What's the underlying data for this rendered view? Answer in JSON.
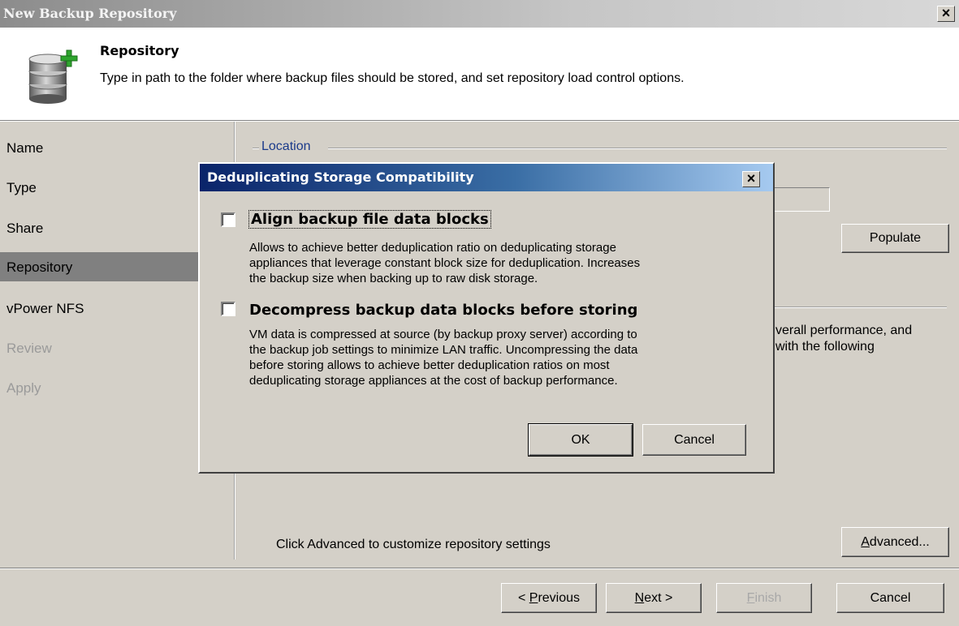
{
  "window": {
    "title": "New Backup Repository",
    "close_glyph": "×"
  },
  "header": {
    "icon": "database-add-icon",
    "title": "Repository",
    "description": "Type in path to the folder where backup files should be stored, and set repository load control options."
  },
  "nav": {
    "selected": "Repository",
    "items": [
      {
        "label": "Name",
        "enabled": true
      },
      {
        "label": "Type",
        "enabled": true
      },
      {
        "label": "Share",
        "enabled": true
      },
      {
        "label": "Repository",
        "enabled": true
      },
      {
        "label": "vPower NFS",
        "enabled": true
      },
      {
        "label": "Review",
        "enabled": false
      },
      {
        "label": "Apply",
        "enabled": false
      }
    ]
  },
  "main": {
    "location_group": "Location",
    "populate_button": "Populate",
    "partial_text_1": "verall performance, and",
    "partial_text_2": "with the following",
    "advanced_hint": "Click Advanced to customize repository settings",
    "advanced_button": {
      "accel": "A",
      "rest": "dvanced..."
    }
  },
  "footer": {
    "previous": {
      "prefix": "< ",
      "accel": "P",
      "rest": "revious"
    },
    "next": {
      "accel": "N",
      "rest": "ext >"
    },
    "finish": {
      "accel": "F",
      "rest": "inish",
      "enabled": false
    },
    "cancel": "Cancel"
  },
  "dialog": {
    "title": "Deduplicating Storage Compatibility",
    "close_glyph": "×",
    "options": [
      {
        "checked": false,
        "label": "Align backup file data blocks",
        "desc_lines": [
          "Allows to achieve better deduplication ratio on deduplicating storage",
          "appliances that leverage constant block size for deduplication. Increases",
          "the backup size when backing up to raw disk storage."
        ]
      },
      {
        "checked": false,
        "label": "Decompress backup data blocks before storing",
        "desc_lines": [
          "VM data is compressed at source (by backup proxy server) according to",
          "the backup job settings to minimize LAN traffic. Uncompressing the data",
          "before storing allows to achieve better deduplication ratios on most",
          "deduplicating storage appliances at the cost of backup performance."
        ]
      }
    ],
    "ok_button": "OK",
    "cancel_button": "Cancel"
  }
}
